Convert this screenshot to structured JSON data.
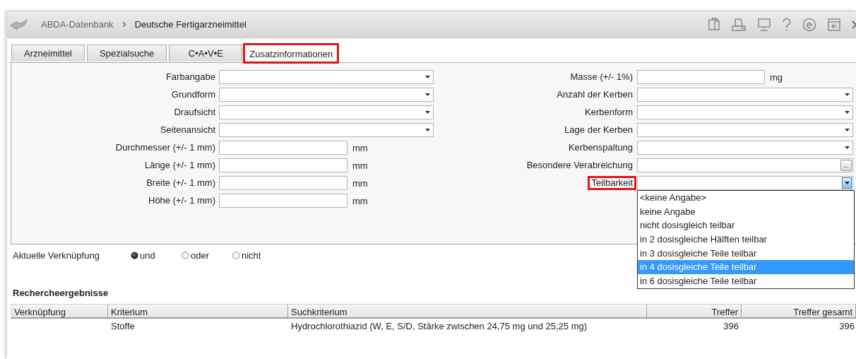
{
  "header": {
    "breadcrumb": [
      "ABDA-Datenbank",
      "Deutsche Fertigarzneimittel"
    ]
  },
  "tabs": [
    {
      "label": "Arzneimittel",
      "selected": false,
      "highlighted": false
    },
    {
      "label": "Spezialsuche",
      "selected": false,
      "highlighted": false
    },
    {
      "label": "C•A•V•E",
      "selected": false,
      "highlighted": false
    },
    {
      "label": "Zusatzinformationen",
      "selected": true,
      "highlighted": true
    }
  ],
  "left_fields": [
    {
      "label": "Farbangabe",
      "kind": "dropdown",
      "expanded": false
    },
    {
      "label": "Grundform",
      "kind": "dropdown",
      "expanded": false
    },
    {
      "label": "Draufsicht",
      "kind": "dropdown",
      "expanded": false
    },
    {
      "label": "Seitenansicht",
      "kind": "dropdown",
      "expanded": false
    },
    {
      "label": "Durchmesser (+/- 1 mm)",
      "kind": "text",
      "unit": "mm"
    },
    {
      "label": "Länge (+/- 1 mm)",
      "kind": "text",
      "unit": "mm"
    },
    {
      "label": "Breite (+/- 1 mm)",
      "kind": "text",
      "unit": "mm"
    },
    {
      "label": "Höhe (+/- 1 mm)",
      "kind": "text",
      "unit": "mm"
    }
  ],
  "right_fields": [
    {
      "label": "Masse (+/- 1%)",
      "kind": "text",
      "unit": "mg",
      "highlighted": false
    },
    {
      "label": "Anzahl der Kerben",
      "kind": "dropdown",
      "expanded": false,
      "highlighted": false
    },
    {
      "label": "Kerbenform",
      "kind": "dropdown",
      "expanded": false,
      "highlighted": false
    },
    {
      "label": "Lage der Kerben",
      "kind": "dropdown",
      "expanded": false,
      "highlighted": false
    },
    {
      "label": "Kerbenspaltung",
      "kind": "dropdown",
      "expanded": false,
      "highlighted": false
    },
    {
      "label": "Besondere Verabreichung",
      "kind": "browse",
      "button": "...",
      "highlighted": false
    },
    {
      "label": "Teilbarkeit",
      "kind": "dropdown",
      "expanded": true,
      "highlighted": true,
      "options": [
        {
          "label": "<keine Angabe>",
          "selected": false
        },
        {
          "label": "keine Angabe",
          "selected": false
        },
        {
          "label": "nicht dosisgleich teilbar",
          "selected": false
        },
        {
          "label": "in 2 dosisgleiche Hälften teilbar",
          "selected": false
        },
        {
          "label": "in 3 dosisgleiche Teile teilbar",
          "selected": false
        },
        {
          "label": "in 4 dosisgleiche Teile teilbar",
          "selected": true
        },
        {
          "label": "in 6 dosisgleiche Teile teilbar",
          "selected": false
        }
      ]
    }
  ],
  "logic": {
    "label": "Aktuelle Verknüpfung",
    "options": [
      {
        "label": "und",
        "selected": true
      },
      {
        "label": "oder",
        "selected": false
      },
      {
        "label": "nicht",
        "selected": false
      }
    ]
  },
  "results": {
    "title": "Rechercheergebnisse",
    "columns": [
      {
        "label": "Verknüpfung",
        "kind": "text"
      },
      {
        "label": "Kriterium",
        "kind": "text"
      },
      {
        "label": "Suchkriterium",
        "kind": "text"
      },
      {
        "label": "Treffer",
        "kind": "number"
      },
      {
        "label": "Treffer gesamt",
        "kind": "number"
      }
    ],
    "rows": [
      {
        "cells": [
          null,
          "Stoffe",
          "Hydrochlorothiazid (W, E, S/D, Stärke zwischen 24,75 mg und 25,25 mg)",
          "396",
          "396"
        ]
      }
    ]
  }
}
